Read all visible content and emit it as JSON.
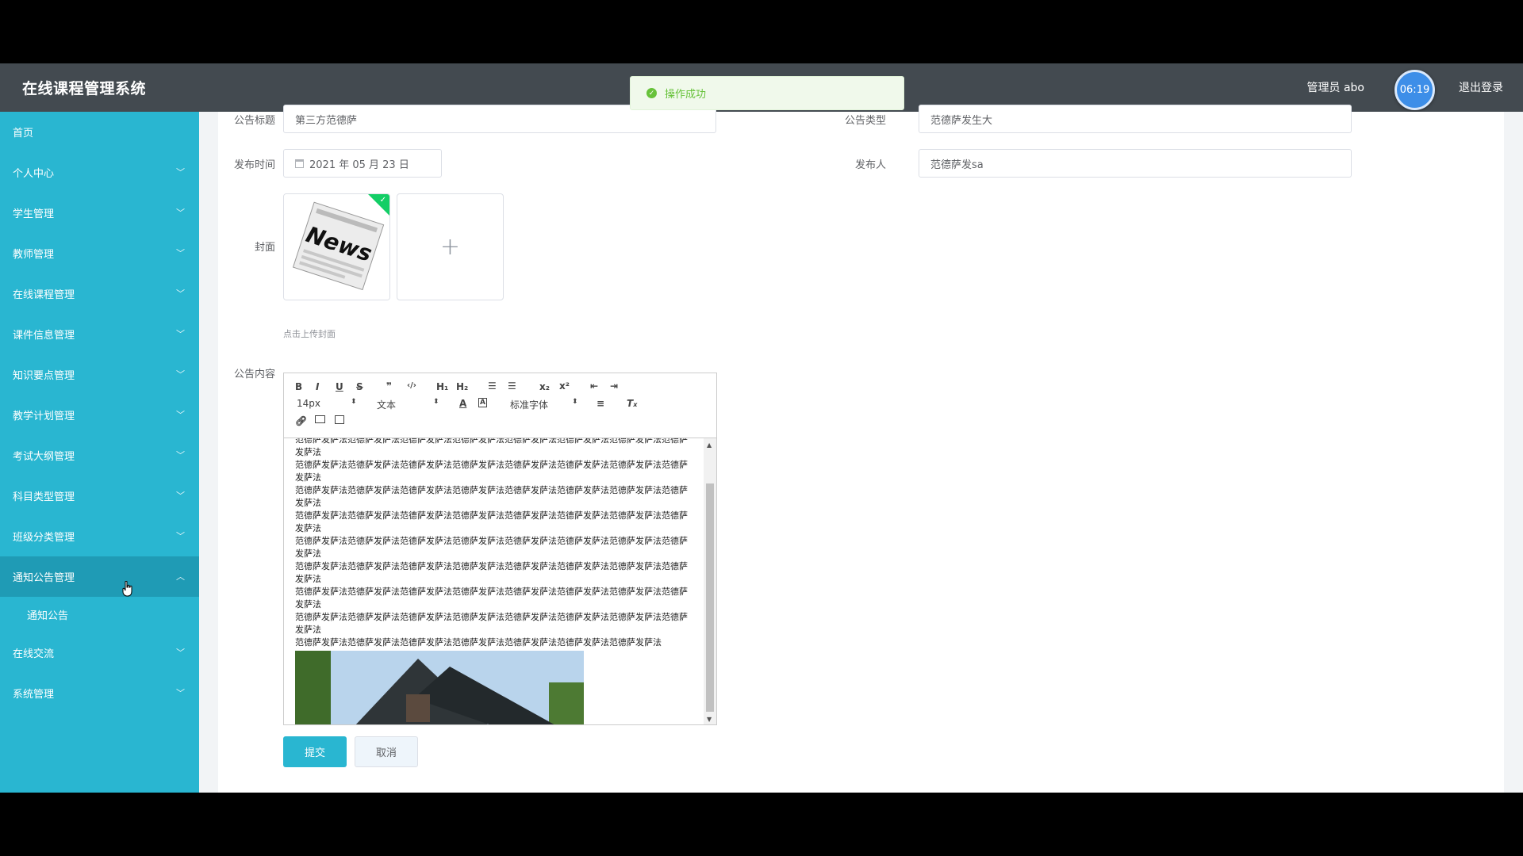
{
  "header": {
    "brand": "在线课程管理系统",
    "user": "管理员 abo",
    "logout_partial": "退",
    "logout": "退出登录",
    "timer": "06:19"
  },
  "toast": {
    "message": "操作成功",
    "icon": "check-circle-icon"
  },
  "sidebar": {
    "items": [
      {
        "label": "首页",
        "has_chevron": false
      },
      {
        "label": "个人中心",
        "has_chevron": true
      },
      {
        "label": "学生管理",
        "has_chevron": true
      },
      {
        "label": "教师管理",
        "has_chevron": true
      },
      {
        "label": "在线课程管理",
        "has_chevron": true
      },
      {
        "label": "课件信息管理",
        "has_chevron": true
      },
      {
        "label": "知识要点管理",
        "has_chevron": true
      },
      {
        "label": "教学计划管理",
        "has_chevron": true
      },
      {
        "label": "考试大纲管理",
        "has_chevron": true
      },
      {
        "label": "科目类型管理",
        "has_chevron": true
      },
      {
        "label": "班级分类管理",
        "has_chevron": true
      },
      {
        "label": "通知公告管理",
        "has_chevron": true,
        "expanded": true
      },
      {
        "label": "在线交流",
        "has_chevron": true
      },
      {
        "label": "系统管理",
        "has_chevron": true
      }
    ],
    "subitem": "通知公告"
  },
  "form": {
    "title_label": "公告标题",
    "title_value": "第三方范德萨",
    "type_label": "公告类型",
    "type_value": "范德萨发生大",
    "time_label": "发布时间",
    "time_value": "2021 年 05 月 23 日",
    "publisher_label": "发布人",
    "publisher_value": "范德萨发sa",
    "cover_label": "封面",
    "cover_hint": "点击上传封面",
    "content_label": "公告内容",
    "cover_image_text": "News",
    "submit": "提交",
    "cancel": "取消"
  },
  "editor": {
    "font_size": "14px",
    "block_format": "文本",
    "font_family": "标准字体",
    "buttons": [
      "B",
      "I",
      "U",
      "S",
      "99",
      "‹/›",
      "H1",
      "H2",
      "ol",
      "ul",
      "x₂",
      "x²",
      "indent-out",
      "indent-in"
    ],
    "content_lines": [
      "范德萨发萨法范德萨发萨法范德萨发萨法范德萨发萨法范德萨发萨法范德萨发萨法范德萨发萨法范德萨发萨法",
      "范德萨发萨法范德萨发萨法范德萨发萨法范德萨发萨法范德萨发萨法范德萨发萨法范德萨发萨法范德萨发萨法",
      "范德萨发萨法范德萨发萨法范德萨发萨法范德萨发萨法范德萨发萨法范德萨发萨法范德萨发萨法范德萨发萨法",
      "范德萨发萨法范德萨发萨法范德萨发萨法范德萨发萨法范德萨发萨法范德萨发萨法范德萨发萨法范德萨发萨法",
      "范德萨发萨法范德萨发萨法范德萨发萨法范德萨发萨法范德萨发萨法范德萨发萨法范德萨发萨法范德萨发萨法",
      "范德萨发萨法范德萨发萨法范德萨发萨法范德萨发萨法范德萨发萨法范德萨发萨法范德萨发萨法范德萨发萨法",
      "范德萨发萨法范德萨发萨法范德萨发萨法范德萨发萨法范德萨发萨法范德萨发萨法范德萨发萨法范德萨发萨法",
      "范德萨发萨法范德萨发萨法范德萨发萨法范德萨发萨法范德萨发萨法范德萨发萨法范德萨发萨法范德萨发萨法",
      "范德萨发萨法范德萨发萨法范德萨发萨法范德萨发萨法范德萨发萨法范德萨发萨法范德萨发萨法"
    ]
  },
  "colors": {
    "sidebar": "#29b6d1",
    "sidebar_active": "#1f9bb5",
    "topbar": "#434a50",
    "success": "#67c23a",
    "primary": "#29b6d1"
  }
}
